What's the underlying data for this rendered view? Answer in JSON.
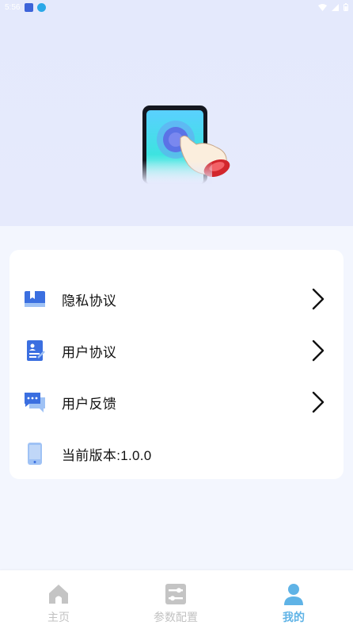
{
  "status_bar": {
    "time": "5:56"
  },
  "menu": {
    "items": [
      {
        "label": "隐私协议",
        "icon": "privacy-book-icon",
        "has_chevron": true
      },
      {
        "label": "用户协议",
        "icon": "user-agreement-icon",
        "has_chevron": true
      },
      {
        "label": "用户反馈",
        "icon": "feedback-chat-icon",
        "has_chevron": true
      },
      {
        "label": "当前版本:1.0.0",
        "icon": "phone-icon",
        "has_chevron": false
      }
    ]
  },
  "tabbar": {
    "tabs": [
      {
        "label": "主页",
        "icon": "home-icon",
        "active": false
      },
      {
        "label": "参数配置",
        "icon": "settings-sliders-icon",
        "active": false
      },
      {
        "label": "我的",
        "icon": "profile-icon",
        "active": true
      }
    ]
  },
  "colors": {
    "header_bg": "#e4e9fc",
    "page_bg": "#f3f6fe",
    "accent": "#5fb3e6",
    "inactive_tab": "#c2c2c2",
    "icon_blue": "#3b6fe0"
  }
}
